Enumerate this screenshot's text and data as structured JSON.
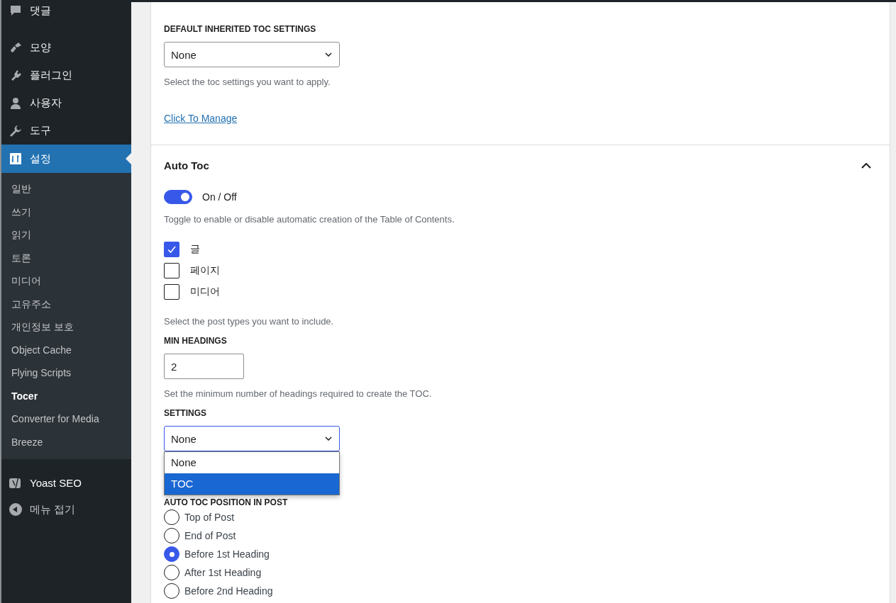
{
  "sidebar": {
    "menu": [
      {
        "label": "댓글",
        "selected": false
      },
      {
        "label": "모양",
        "selected": false
      },
      {
        "label": "플러그인",
        "selected": false
      },
      {
        "label": "사용자",
        "selected": false
      },
      {
        "label": "도구",
        "selected": false
      },
      {
        "label": "설정",
        "selected": true
      }
    ],
    "submenu": [
      {
        "label": "일반",
        "selected": false
      },
      {
        "label": "쓰기",
        "selected": false
      },
      {
        "label": "읽기",
        "selected": false
      },
      {
        "label": "토론",
        "selected": false
      },
      {
        "label": "미디어",
        "selected": false
      },
      {
        "label": "고유주소",
        "selected": false
      },
      {
        "label": "개인정보 보호",
        "selected": false
      },
      {
        "label": "Object Cache",
        "selected": false
      },
      {
        "label": "Flying Scripts",
        "selected": false
      },
      {
        "label": "Tocer",
        "selected": true
      },
      {
        "label": "Converter for Media",
        "selected": false
      },
      {
        "label": "Breeze",
        "selected": false
      }
    ],
    "extra": [
      {
        "label": "Yoast SEO"
      },
      {
        "label": "메뉴 접기"
      }
    ]
  },
  "inherited": {
    "label": "DEFAULT INHERITED TOC SETTINGS",
    "select": {
      "value": "None"
    },
    "help": "Select the toc settings you want to apply.",
    "link": "Click To Manage"
  },
  "auto_toc": {
    "title": "Auto Toc",
    "expanded": true,
    "toggle": {
      "on": true,
      "label": "On / Off"
    },
    "toggle_help": "Toggle to enable or disable automatic creation of the Table of Contents.",
    "post_types": [
      {
        "label": "글",
        "checked": true
      },
      {
        "label": "페이지",
        "checked": false
      },
      {
        "label": "미디어",
        "checked": false
      }
    ],
    "post_types_help": "Select the post types you want to include.",
    "min_headings": {
      "label": "MIN HEADINGS",
      "value": "2",
      "help": "Set the minimum number of headings required to create the TOC."
    },
    "settings": {
      "label": "SETTINGS",
      "value": "None",
      "open": true,
      "options": [
        {
          "label": "None",
          "highlighted": false
        },
        {
          "label": "TOC",
          "highlighted": true
        }
      ]
    },
    "position": {
      "label": "AUTO TOC POSITION IN POST",
      "options": [
        {
          "label": "Top of Post",
          "selected": false
        },
        {
          "label": "End of Post",
          "selected": false
        },
        {
          "label": "Before 1st Heading",
          "selected": true
        },
        {
          "label": "After 1st Heading",
          "selected": false
        },
        {
          "label": "Before 2nd Heading",
          "selected": false
        }
      ]
    }
  }
}
